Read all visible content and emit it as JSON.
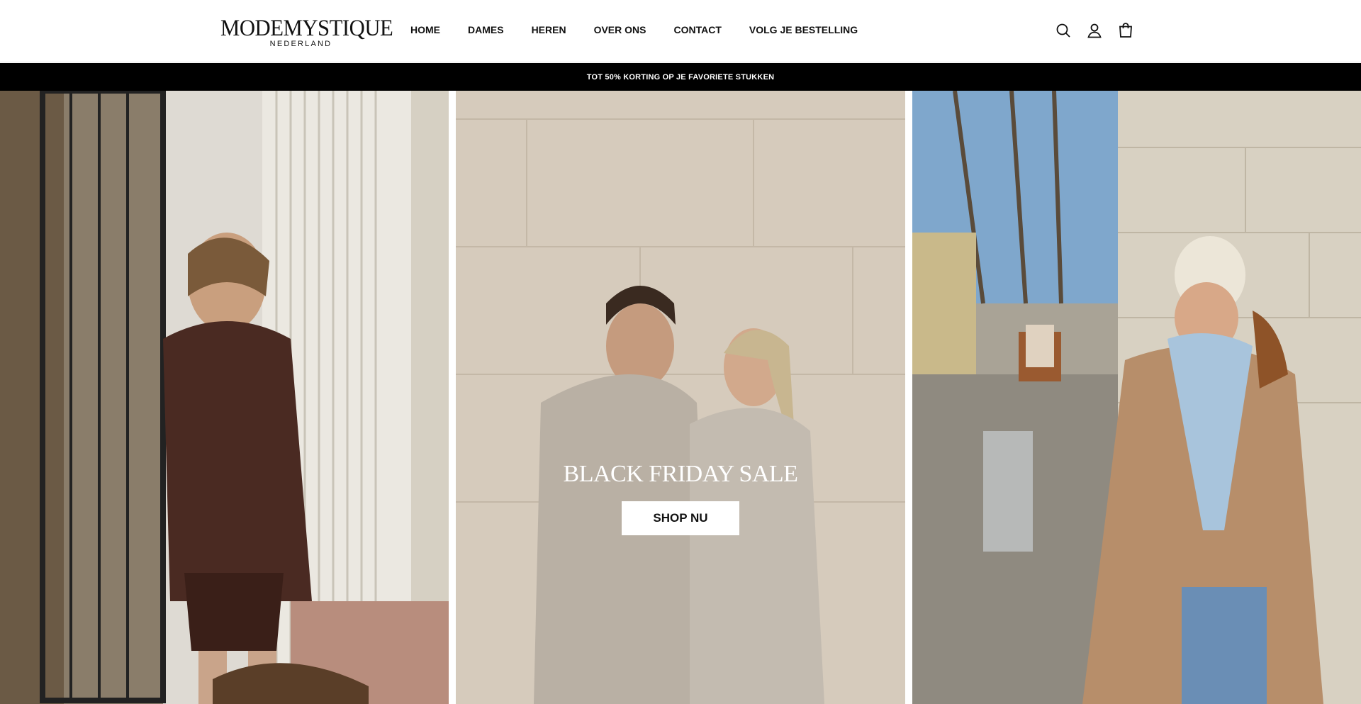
{
  "header": {
    "logo": {
      "main": "MODEMYSTIQUE",
      "sub": "NEDERLAND"
    },
    "nav": [
      "HOME",
      "DAMES",
      "HEREN",
      "OVER ONS",
      "CONTACT",
      "VOLG JE BESTELLING"
    ],
    "icons": [
      "search-icon",
      "account-icon",
      "cart-icon"
    ]
  },
  "announcement": {
    "text": "TOT 50% KORTING OP JE FAVORIETE STUKKEN"
  },
  "hero": {
    "title": "BLACK FRIDAY SALE",
    "button": "SHOP NU"
  },
  "colors": {
    "announcement_bg": "#000000",
    "announcement_text": "#ffffff",
    "button_bg": "#ffffff"
  }
}
